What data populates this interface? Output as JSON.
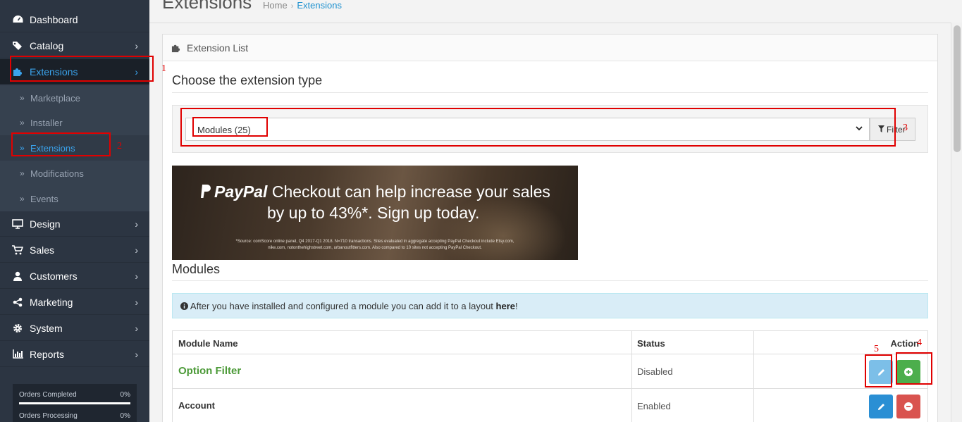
{
  "sidebar": {
    "items": [
      {
        "label": "Dashboard",
        "icon": "dashboard-icon"
      },
      {
        "label": "Catalog",
        "icon": "tags-icon"
      },
      {
        "label": "Extensions",
        "icon": "puzzle-icon"
      },
      {
        "label": "Design",
        "icon": "monitor-icon"
      },
      {
        "label": "Sales",
        "icon": "cart-icon"
      },
      {
        "label": "Customers",
        "icon": "user-icon"
      },
      {
        "label": "Marketing",
        "icon": "share-icon"
      },
      {
        "label": "System",
        "icon": "gear-icon"
      },
      {
        "label": "Reports",
        "icon": "bar-chart-icon"
      }
    ],
    "sub_items": [
      {
        "label": "Marketplace"
      },
      {
        "label": "Installer"
      },
      {
        "label": "Extensions"
      },
      {
        "label": "Modifications"
      },
      {
        "label": "Events"
      }
    ],
    "stats": [
      {
        "label": "Orders Completed",
        "value": "0%"
      },
      {
        "label": "Orders Processing",
        "value": "0%"
      }
    ]
  },
  "header": {
    "title": "Extensions",
    "breadcrumb": [
      "Home",
      "Extensions"
    ]
  },
  "panel": {
    "heading": "Extension List",
    "choose_title": "Choose the extension type",
    "select_value": "Modules (25)",
    "filter_label": "Filter",
    "banner": {
      "brand": "PayPal",
      "line1_rest": " Checkout can help increase your sales",
      "line2": "by up to 43%*. Sign up today.",
      "footnote": "*Source: comScore online panel, Q4 2017-Q1 2018. N=710 transactions. Sites evaluated in aggregate accepting PayPal Checkout include Etsy.com, nike.com, notonthehighstreet.com, urbanoutfitters.com. Also compared to 10 sites not accepting PayPal Checkout."
    },
    "modules_title": "Modules",
    "alert_text": "After you have installed and configured a module you can add it to a layout",
    "alert_link": "here",
    "alert_end": "!",
    "table": {
      "headers": [
        "Module Name",
        "Status",
        "Action"
      ],
      "rows": [
        {
          "name": "Option Filter",
          "status": "Disabled"
        },
        {
          "name": "Account",
          "status": "Enabled"
        }
      ]
    }
  },
  "annotations": [
    "1",
    "2",
    "3",
    "4",
    "5"
  ],
  "colors": {
    "sidebar_bg": "#2c3542",
    "accent_blue": "#1e91cf",
    "annotation_red": "#e00000",
    "install_green": "#4cae4c",
    "edit_blue": "#2a8fd4",
    "uninstall_red": "#d9534f"
  }
}
